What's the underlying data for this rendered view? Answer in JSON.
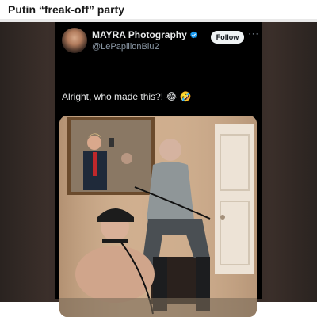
{
  "post": {
    "title": "Putin “freak-off” party"
  },
  "tweet": {
    "display_name": "MAYRA Photography",
    "handle": "@LePapillonBlu2",
    "follow_label": "Follow",
    "more_label": "···",
    "text": "Alright, who made this?! 😂 🤣",
    "icons": {
      "verified": "verified-badge-icon",
      "more": "more-options-icon"
    },
    "colors": {
      "background": "#000000",
      "text": "#e7e9ea",
      "secondary_text": "#8b98a5",
      "verified": "#1d9bf0",
      "follow_button": "#eff3f4"
    }
  }
}
